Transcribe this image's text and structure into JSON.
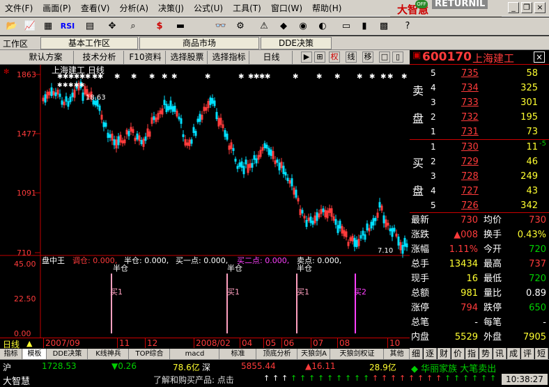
{
  "menu": {
    "items": [
      "文件(F)",
      "画面(P)",
      "查看(V)",
      "分析(A)",
      "决策(J)",
      "公式(U)",
      "工具(T)",
      "窗口(W)",
      "帮助(H)"
    ]
  },
  "brand": {
    "logo": "大智慧",
    "badge": "OFF",
    "text": "RETURNIL"
  },
  "window": {
    "minimize": "_",
    "restore": "❐",
    "close": "×"
  },
  "toolbar": {
    "buttons": [
      "📂",
      "📈",
      "▦",
      "RSI",
      "▤",
      "✥",
      "⌕",
      "$",
      "▬",
      "👓",
      "⚙",
      "⚠",
      "◆",
      "◉",
      "◐",
      "▭",
      "▮",
      "▩",
      "?"
    ],
    "names": [
      "open-icon",
      "chart-icon",
      "grid-icon",
      "rsi-icon",
      "list-icon",
      "move-icon",
      "zoom-icon",
      "dollar-icon",
      "bar-icon",
      "binoculars-icon",
      "settings-icon",
      "alert-icon",
      "diamond-icon",
      "circle-icon",
      "half-circle-icon",
      "window-icon",
      "column-icon",
      "table-icon",
      "help-icon"
    ]
  },
  "tabrow": {
    "label": "工作区",
    "tabs": [
      "基本工作区",
      "商品市场",
      "DDE决策"
    ]
  },
  "chartbar": {
    "buttons": [
      "默认方案",
      "技术分析",
      "F10资料",
      "选择股票",
      "选择指标",
      "日线"
    ],
    "icons": [
      "▶",
      "⊞",
      "权",
      "线",
      "移",
      "□",
      "▯",
      "▣"
    ]
  },
  "chart": {
    "title": "上海建工 日线",
    "price_labels": [
      "1863",
      "1477",
      "1091",
      "710"
    ],
    "high_label": "1863",
    "high_value": "18.63",
    "low_value": "7.10",
    "volume_labels": [
      "45.00",
      "22.50",
      "0.00"
    ]
  },
  "indicator": {
    "name": "盘中王",
    "items": [
      {
        "label": "调仓: 0.000,",
        "color": "#ff3b3b"
      },
      {
        "label": "半仓: 0.000,",
        "color": "#ffffff"
      },
      {
        "label": "买一点: 0.000,",
        "color": "#ffffff"
      },
      {
        "label": "买二点: 0.000,",
        "color": "#ff40ff"
      },
      {
        "label": "卖点: 0.000,",
        "color": "#ffffff"
      }
    ]
  },
  "signals": [
    {
      "text": "半仓",
      "color": "#ffffff"
    },
    {
      "text": "买1",
      "color": "#ffa0c0"
    },
    {
      "text": "半仓",
      "color": "#ffffff"
    },
    {
      "text": "买1",
      "color": "#ffa0c0"
    },
    {
      "text": "半仓",
      "color": "#ffffff"
    },
    {
      "text": "买1",
      "color": "#ffa0c0"
    },
    {
      "text": "买2",
      "color": "#ff40ff"
    }
  ],
  "xaxis": {
    "period": "日线",
    "labels": [
      "2007/09",
      "11",
      "12",
      "2008/02",
      "04",
      "05",
      "06",
      "07",
      "08",
      "10"
    ]
  },
  "bottomtabs": [
    "指标",
    "模板",
    "DDE决策",
    "K线神兵",
    "TOP综合",
    "macd",
    "标准",
    "顶底分析",
    "天狼剑A",
    "天狼剑权证",
    "其他"
  ],
  "stock": {
    "code": "600170",
    "name": "上海建工",
    "close": "×"
  },
  "sell": {
    "side_label_top": "卖",
    "side_label_bottom": "盘",
    "rows": [
      {
        "level": "5",
        "price": "735",
        "vol": "58"
      },
      {
        "level": "4",
        "price": "734",
        "vol": "325"
      },
      {
        "level": "3",
        "price": "733",
        "vol": "301"
      },
      {
        "level": "2",
        "price": "732",
        "vol": "195"
      },
      {
        "level": "1",
        "price": "731",
        "vol": "73"
      }
    ]
  },
  "buy": {
    "side_label_top": "买",
    "side_label_bottom": "盘",
    "diff": "-5",
    "rows": [
      {
        "level": "1",
        "price": "730",
        "vol": "11"
      },
      {
        "level": "2",
        "price": "729",
        "vol": "46"
      },
      {
        "level": "3",
        "price": "728",
        "vol": "249"
      },
      {
        "level": "4",
        "price": "727",
        "vol": "43"
      },
      {
        "level": "5",
        "price": "726",
        "vol": "342"
      }
    ]
  },
  "quote": {
    "rows": [
      {
        "l1": "最新",
        "v1": "730",
        "c1": "red",
        "l2": "均价",
        "v2": "730",
        "c2": "red"
      },
      {
        "l1": "涨跌",
        "v1": "▲008",
        "c1": "red",
        "l2": "换手",
        "v2": "0.43%",
        "c2": "yel"
      },
      {
        "l1": "涨幅",
        "v1": "1.11%",
        "c1": "red",
        "l2": "今开",
        "v2": "720",
        "c2": "grn"
      },
      {
        "l1": "总手",
        "v1": "13434",
        "c1": "yel",
        "l2": "最高",
        "v2": "737",
        "c2": "red"
      },
      {
        "l1": "现手",
        "v1": "16",
        "c1": "yel",
        "l2": "最低",
        "v2": "720",
        "c2": "grn"
      },
      {
        "l1": "总额",
        "v1": "981",
        "c1": "yel",
        "l2": "量比",
        "v2": "0.89",
        "c2": "wht"
      },
      {
        "l1": "涨停",
        "v1": "794",
        "c1": "red",
        "l2": "跌停",
        "v2": "650",
        "c2": "grn"
      },
      {
        "l1": "总笔",
        "v1": "-",
        "c1": "wht",
        "l2": "每笔",
        "v2": "-",
        "c2": "wht"
      },
      {
        "l1": "内盘",
        "v1": "5529",
        "c1": "yel",
        "l2": "外盘",
        "v2": "7905",
        "c2": "yel"
      }
    ]
  },
  "righttabs": [
    "细",
    "逐",
    "财",
    "价",
    "指",
    "势",
    "讯",
    "成",
    "评",
    "短"
  ],
  "status": {
    "sh_label": "沪",
    "sh_index": "1728.53",
    "sh_change": "▼0.26",
    "sh_amount": "78.6亿",
    "sz_label": "深",
    "sz_index": "5855.44",
    "sz_change": "▲16.11",
    "sz_amount": "28.9亿",
    "news": "◆ 华丽家族 大笔卖出",
    "brand": "大智慧",
    "ticker": "了解和购买产品: 点击",
    "time": "10:38:27"
  },
  "colors": {
    "up": "#ff3b3b",
    "down": "#00e0ff",
    "axis": "#c00000"
  }
}
